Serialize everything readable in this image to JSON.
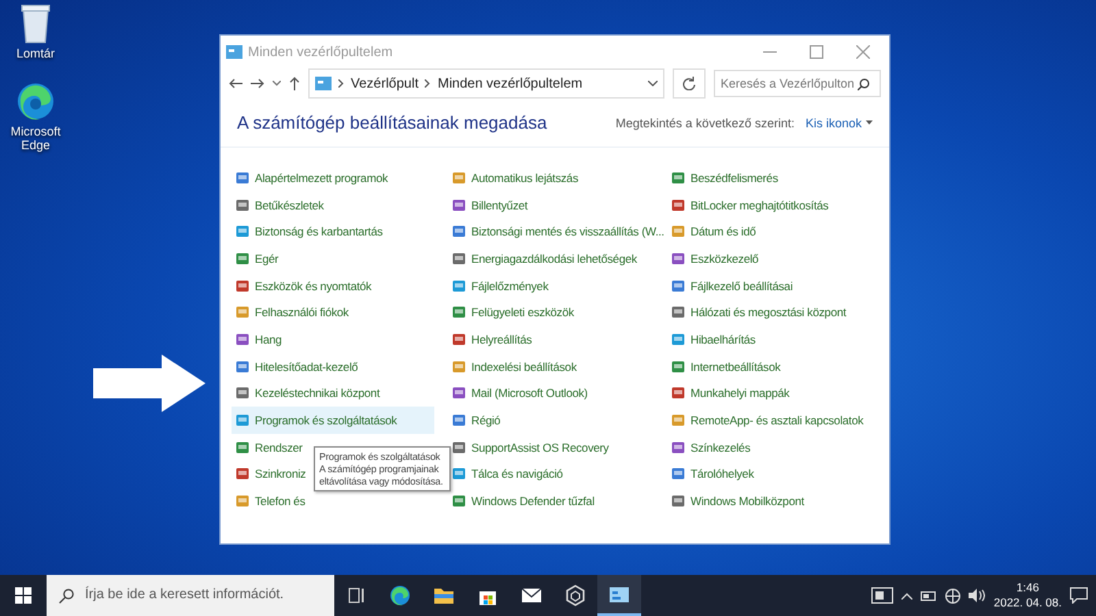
{
  "desktop": {
    "icons": [
      {
        "label": "Lomtár",
        "kind": "bin"
      },
      {
        "label": "Microsoft Edge",
        "kind": "edge"
      }
    ]
  },
  "window": {
    "title": "Minden vezérlőpultelem",
    "address": {
      "crumbs": [
        "Vezérlőpult",
        "Minden vezérlőpultelem"
      ]
    },
    "search": {
      "placeholder": "Keresés a Vezérlőpulton"
    },
    "heading": "A számítógép beállításainak megadása",
    "view_by": {
      "label": "Megtekintés a következő szerint:",
      "value": "Kis ikonok"
    },
    "columns": [
      [
        {
          "label": "Alapértelmezett programok",
          "selected": false
        },
        {
          "label": "Betűkészletek",
          "selected": false
        },
        {
          "label": "Biztonság és karbantartás",
          "selected": false
        },
        {
          "label": "Egér",
          "selected": false
        },
        {
          "label": "Eszközök és nyomtatók",
          "selected": false
        },
        {
          "label": "Felhasználói fiókok",
          "selected": false
        },
        {
          "label": "Hang",
          "selected": false
        },
        {
          "label": "Hitelesítőadat-kezelő",
          "selected": false
        },
        {
          "label": "Kezeléstechnikai központ",
          "selected": false
        },
        {
          "label": "Programok és szolgáltatások",
          "selected": true
        },
        {
          "label": "Rendszer",
          "selected": false
        },
        {
          "label": "Szinkroniz",
          "selected": false
        },
        {
          "label": "Telefon és",
          "selected": false
        }
      ],
      [
        {
          "label": "Automatikus lejátszás",
          "selected": false
        },
        {
          "label": "Billentyűzet",
          "selected": false
        },
        {
          "label": "Biztonsági mentés és visszaállítás (W...",
          "selected": false
        },
        {
          "label": "Energiagazdálkodási lehetőségek",
          "selected": false
        },
        {
          "label": "Fájlelőzmények",
          "selected": false
        },
        {
          "label": "Felügyeleti eszközök",
          "selected": false
        },
        {
          "label": "Helyreállítás",
          "selected": false
        },
        {
          "label": "Indexelési beállítások",
          "selected": false
        },
        {
          "label": "Mail (Microsoft Outlook)",
          "selected": false
        },
        {
          "label": "Régió",
          "selected": false
        },
        {
          "label": "SupportAssist OS Recovery",
          "selected": false
        },
        {
          "label": "Tálca és navigáció",
          "selected": false
        },
        {
          "label": "Windows Defender tűzfal",
          "selected": false
        }
      ],
      [
        {
          "label": "Beszédfelismerés",
          "selected": false
        },
        {
          "label": "BitLocker meghajtótitkosítás",
          "selected": false
        },
        {
          "label": "Dátum és idő",
          "selected": false
        },
        {
          "label": "Eszközkezelő",
          "selected": false
        },
        {
          "label": "Fájlkezelő beállításai",
          "selected": false
        },
        {
          "label": "Hálózati és megosztási központ",
          "selected": false
        },
        {
          "label": "Hibaelhárítás",
          "selected": false
        },
        {
          "label": "Internetbeállítások",
          "selected": false
        },
        {
          "label": "Munkahelyi mappák",
          "selected": false
        },
        {
          "label": "RemoteApp- és asztali kapcsolatok",
          "selected": false
        },
        {
          "label": "Színkezelés",
          "selected": false
        },
        {
          "label": "Tárolóhelyek",
          "selected": false
        },
        {
          "label": "Windows Mobilközpont",
          "selected": false
        }
      ]
    ],
    "tooltip": {
      "title": "Programok és szolgáltatások",
      "text": "A számítógép programjainak eltávolítása vagy módosítása."
    }
  },
  "taskbar": {
    "search": {
      "placeholder": "Írja be ide a keresett információt."
    },
    "apps": [
      {
        "kind": "taskview",
        "selected": false
      },
      {
        "kind": "edge",
        "selected": false
      },
      {
        "kind": "folder",
        "selected": false
      },
      {
        "kind": "store",
        "selected": false
      },
      {
        "kind": "mail",
        "selected": false
      },
      {
        "kind": "cube",
        "selected": false
      },
      {
        "kind": "panel",
        "selected": true
      }
    ],
    "time": "1:46",
    "date": "2022. 04. 08."
  }
}
